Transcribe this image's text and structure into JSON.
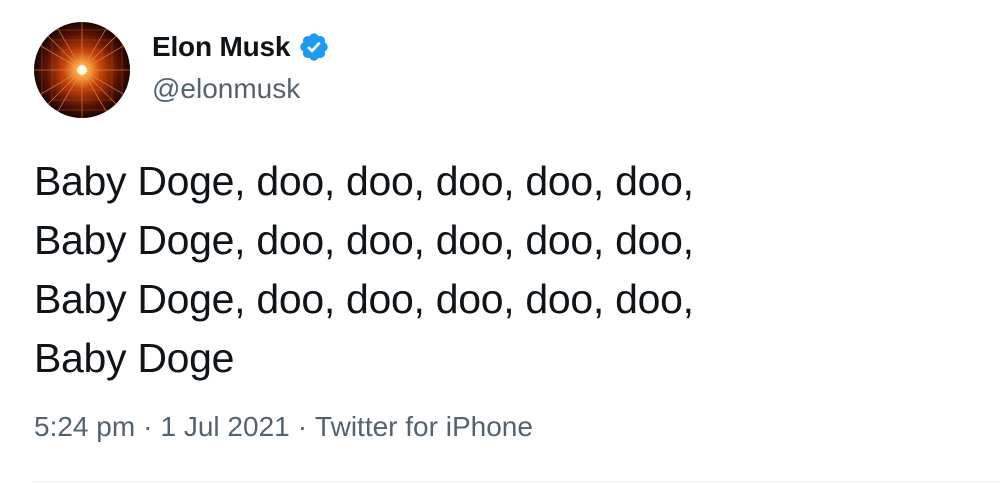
{
  "author": {
    "name": "Elon Musk",
    "handle": "@elonmusk",
    "verified": true,
    "verified_color": "#1d9bf0"
  },
  "tweet": {
    "lines": [
      "Baby Doge, doo, doo, doo, doo, doo,",
      "Baby Doge, doo, doo, doo, doo, doo,",
      "Baby Doge, doo, doo, doo, doo, doo,",
      "Baby Doge"
    ]
  },
  "meta": {
    "time": "5:24 pm",
    "separator": "·",
    "date": "1 Jul 2021",
    "source": "Twitter for iPhone"
  },
  "icons": {
    "avatar": "starburst-avatar",
    "verified": "verified-badge-icon"
  }
}
